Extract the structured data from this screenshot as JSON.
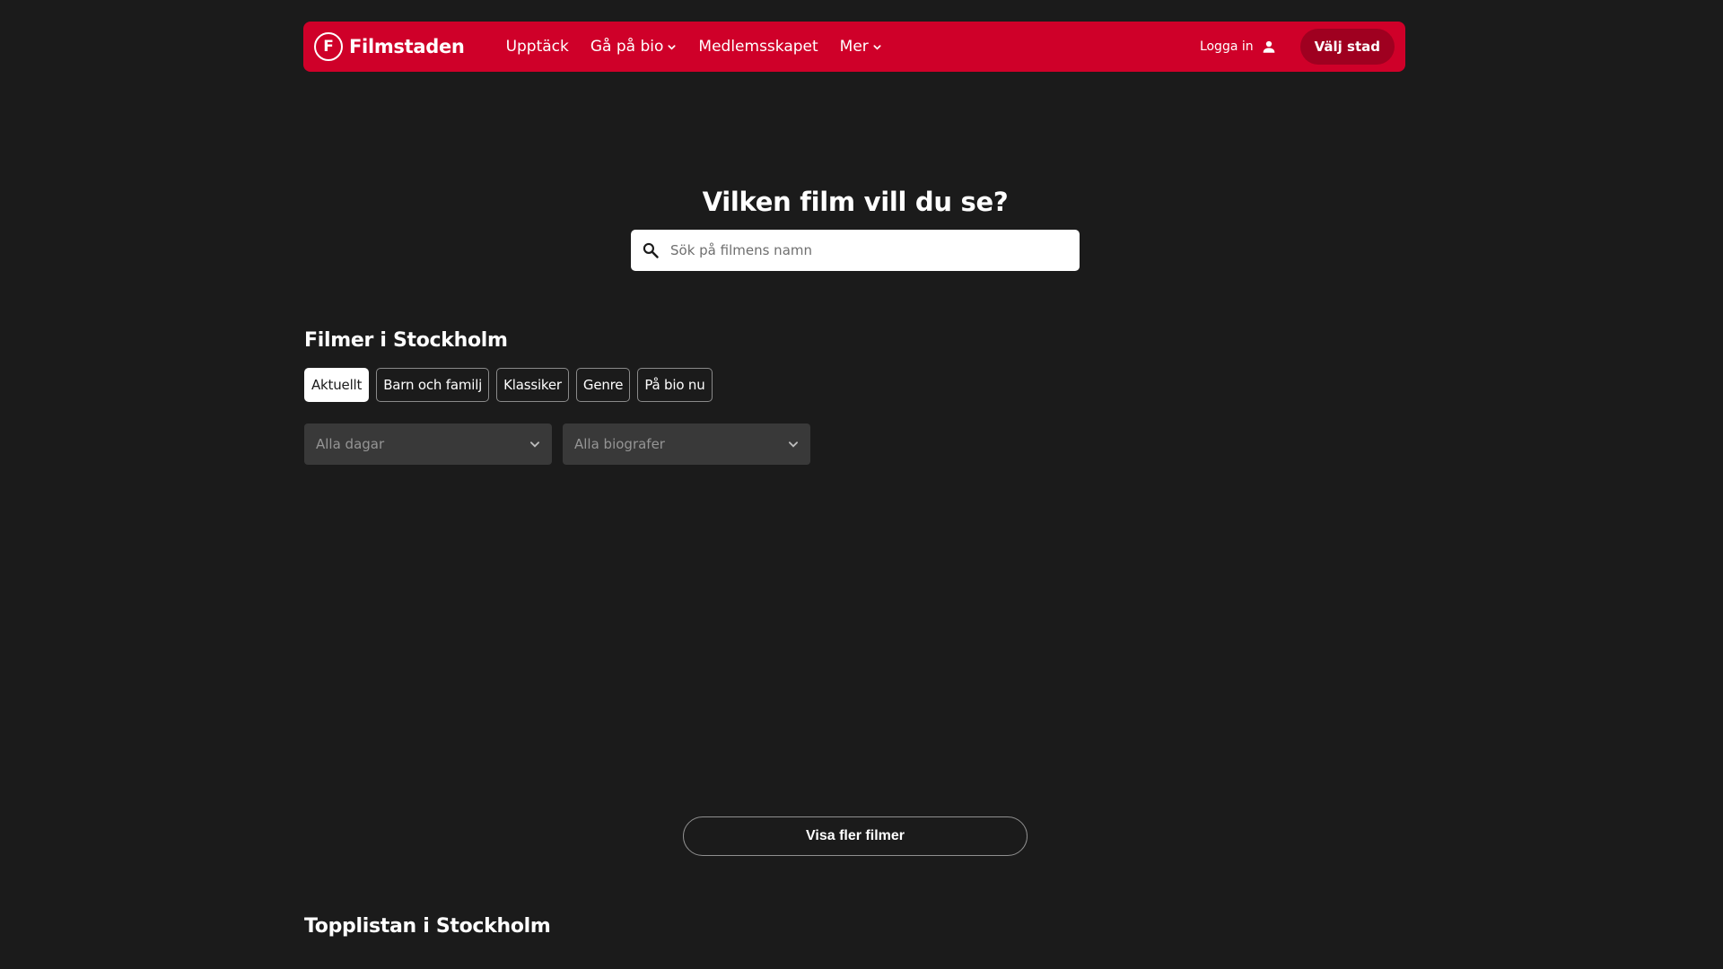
{
  "brand": {
    "name": "Filmstaden",
    "mark": "F"
  },
  "nav": {
    "links": [
      {
        "label": "Upptäck"
      },
      {
        "label": "Gå på bio"
      },
      {
        "label": "Medlemsskapet"
      },
      {
        "label": "Mer"
      }
    ],
    "login_label": "Logga in",
    "city_button": "Välj stad"
  },
  "hero": {
    "title": "Vilken film vill du se?",
    "search_placeholder": "Sök på filmens namn"
  },
  "films": {
    "title": "Filmer i Stockholm",
    "chips": [
      {
        "label": "Aktuellt",
        "active": true
      },
      {
        "label": "Barn och familj",
        "active": false
      },
      {
        "label": "Klassiker",
        "active": false
      },
      {
        "label": "Genre",
        "active": false
      },
      {
        "label": "På bio nu",
        "active": false
      }
    ],
    "filters": {
      "days": "Alla dagar",
      "cinemas": "Alla biografer"
    },
    "more_button": "Visa fler filmer"
  },
  "toplist": {
    "title": "Topplistan i Stockholm"
  },
  "colors": {
    "brand_red": "#cf0029",
    "button_dark_red": "#9f0020",
    "background": "#1b1b1b"
  },
  "icons": [
    "search-icon",
    "user-icon",
    "chevron-down-icon"
  ]
}
